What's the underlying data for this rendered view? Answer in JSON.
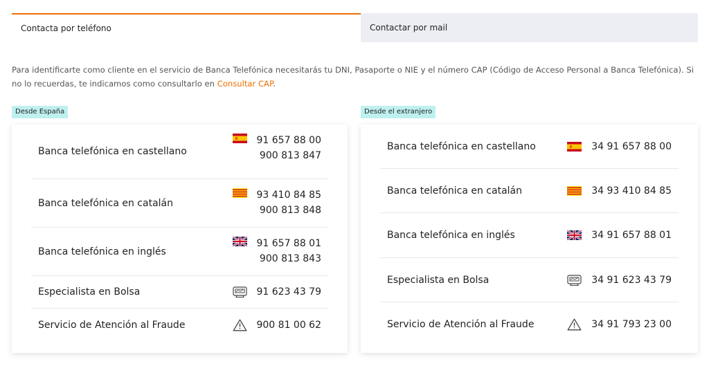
{
  "tabs": {
    "phone": "Contacta por teléfono",
    "mail": "Contactar por mail"
  },
  "intro": {
    "text": "Para identificarte como cliente en el servicio de Banca Telefónica necesitarás tu DNI, Pasaporte o NIE y el número CAP (Código de Acceso Personal a Banca Telefónica). Si no lo recuerdas, te indicamos como consultarlo en ",
    "link": "Consultar CAP",
    "suffix": "."
  },
  "spain": {
    "badge": "Desde España",
    "rows": [
      {
        "label": "Banca telefónica en castellano",
        "icon": "spain-flag-icon",
        "n1": "91 657 88 00",
        "n2": "900 813 847"
      },
      {
        "label": "Banca telefónica en catalán",
        "icon": "catalonia-flag-icon",
        "n1": "93 410 84 85",
        "n2": "900 813 848"
      },
      {
        "label": "Banca telefónica en inglés",
        "icon": "uk-flag-icon",
        "n1": "91 657 88 01",
        "n2": "900 813 843"
      },
      {
        "label": "Especialista en Bolsa",
        "icon": "trading-terminal-icon",
        "n1": "91 623 43 79"
      },
      {
        "label": "Servicio de Atención al Fraude",
        "icon": "warning-icon",
        "n1": "900 81 00 62"
      }
    ]
  },
  "abroad": {
    "badge": "Desde el extranjero",
    "rows": [
      {
        "label": "Banca telefónica en castellano",
        "icon": "spain-flag-icon",
        "n1": "34 91 657 88 00"
      },
      {
        "label": "Banca telefónica en catalán",
        "icon": "catalonia-flag-icon",
        "n1": "34 93 410 84 85"
      },
      {
        "label": "Banca telefónica en inglés",
        "icon": "uk-flag-icon",
        "n1": "34 91 657 88 01"
      },
      {
        "label": "Especialista en Bolsa",
        "icon": "trading-terminal-icon",
        "n1": "34 91 623 43 79"
      },
      {
        "label": "Servicio de Atención al Fraude",
        "icon": "warning-icon",
        "n1": "34 91 793 23 00"
      }
    ]
  },
  "colors": {
    "accent": "#ec7000",
    "badge": "#bff0f0",
    "inactive_tab": "#eceef3"
  }
}
